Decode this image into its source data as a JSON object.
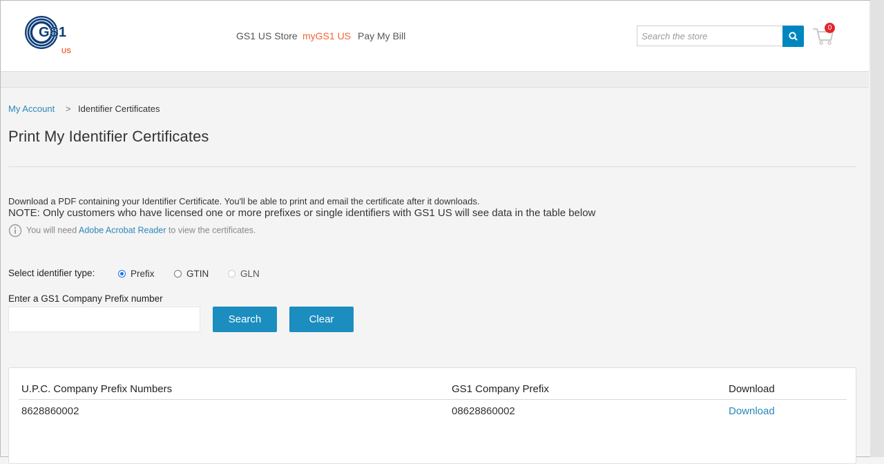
{
  "header": {
    "logo": {
      "main": "GS1",
      "sub": "US"
    },
    "nav": [
      {
        "label": "GS1 US Store",
        "active": false
      },
      {
        "label": "myGS1 US",
        "active": true
      },
      {
        "label": "Pay My Bill",
        "active": false
      }
    ],
    "search": {
      "placeholder": "Search the store",
      "value": ""
    },
    "cart": {
      "count": "0"
    }
  },
  "breadcrumb": {
    "parent": "My Account",
    "separator": ">",
    "current": "Identifier Certificates"
  },
  "page": {
    "title": "Print My Identifier Certificates",
    "description": "Download a PDF containing your Identifier Certificate. You'll be able to print and email the certificate after it downloads.",
    "note": "NOTE: Only customers who have licensed one or more prefixes or single identifiers with GS1 US will see data in the table below",
    "info": {
      "prefix": "You will need ",
      "link": "Adobe Acrobat Reader",
      "suffix": " to view the certificates."
    }
  },
  "form": {
    "type_label": "Select identifier type:",
    "types": [
      {
        "label": "Prefix",
        "state": "checked"
      },
      {
        "label": "GTIN",
        "state": "unchecked"
      },
      {
        "label": "GLN",
        "state": "disabled"
      }
    ],
    "prefix_label": "Enter a GS1 Company Prefix number",
    "prefix_value": "",
    "search_button": "Search",
    "clear_button": "Clear"
  },
  "table": {
    "headers": [
      "U.P.C. Company Prefix Numbers",
      "GS1 Company Prefix",
      "Download"
    ],
    "rows": [
      {
        "upc": "8628860002",
        "gs1": "08628860002",
        "download": "Download"
      }
    ]
  },
  "colors": {
    "accent": "#0086bf",
    "active_nav": "#f26334",
    "link": "#2a87b9",
    "badge": "#e5242b"
  }
}
